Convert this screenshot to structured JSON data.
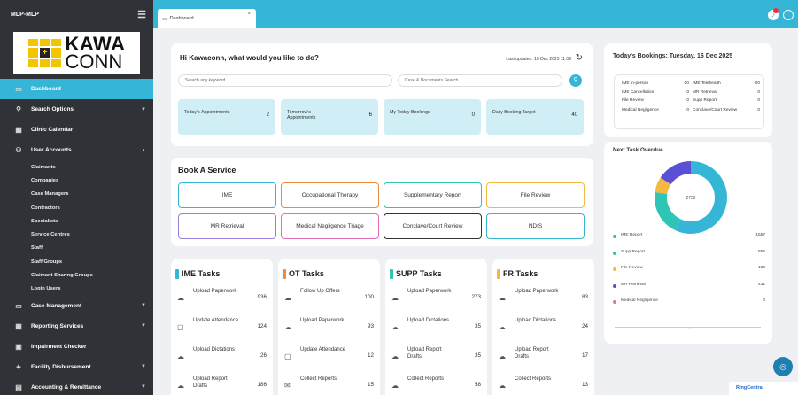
{
  "sidebar": {
    "app_name": "MLP-MLP",
    "logo": {
      "line1": "KAWA",
      "line2": "CONN"
    },
    "items": [
      {
        "label": "Dashboard",
        "icon": "dashboard-icon"
      },
      {
        "label": "Search Options",
        "icon": "search-icon"
      },
      {
        "label": "Clinic Calendar",
        "icon": "calendar-icon"
      },
      {
        "label": "User Accounts",
        "icon": "users-icon"
      }
    ],
    "sub_items": [
      "Claimants",
      "Companies",
      "Case Managers",
      "Contractors",
      "Specialists",
      "Service Centres",
      "Staff",
      "Staff Groups",
      "Claimant Sharing Groups",
      "Login Users"
    ],
    "more_items": [
      {
        "label": "Case Management",
        "icon": "folder-icon"
      },
      {
        "label": "Reporting Services",
        "icon": "grid-icon"
      },
      {
        "label": "Impairment Checker",
        "icon": "checker-icon"
      },
      {
        "label": "Facility Disbursement",
        "icon": "settings-icon"
      },
      {
        "label": "Accounting & Remittance",
        "icon": "accounting-icon"
      }
    ]
  },
  "topbar": {
    "tab_label": "Dashboard"
  },
  "greeting": {
    "title": "Hi Kawaconn, what would you like to do?",
    "updated": "Last updated: 16 Dec 2025 11:09",
    "search_placeholder": "Search any keyword",
    "case_search_placeholder": "Case & Documents Search",
    "stats": [
      {
        "label": "Today's Appointments",
        "value": "2"
      },
      {
        "label": "Tomorrow's Appointments",
        "value": "6"
      },
      {
        "label": "My Today Bookings",
        "value": "0"
      },
      {
        "label": "Daily Booking Target",
        "value": "40"
      }
    ]
  },
  "book": {
    "title": "Book A Service",
    "services": [
      {
        "label": "IME",
        "color": "#35b6d6"
      },
      {
        "label": "Occupational Therapy",
        "color": "#f08a3c"
      },
      {
        "label": "Supplementary Report",
        "color": "#2ec4b6"
      },
      {
        "label": "File Review",
        "color": "#f5b942"
      },
      {
        "label": "MR Retrieval",
        "color": "#9b7fe0"
      },
      {
        "label": "Medical Negligence Triage",
        "color": "#e66bb8"
      },
      {
        "label": "Conclave/Court Review",
        "color": "#333333"
      },
      {
        "label": "NDIS",
        "color": "#35b6d6"
      }
    ]
  },
  "tasks": [
    {
      "title": "IME Tasks",
      "color": "#35b6d6",
      "rows": [
        {
          "icon": "upload-icon",
          "label": "Upload Paperwork",
          "value": "936"
        },
        {
          "icon": "calendar-icon",
          "label": "Update Attendance",
          "value": "124"
        },
        {
          "icon": "upload-icon",
          "label": "Upload Dictations",
          "value": "26"
        },
        {
          "icon": "upload-icon",
          "label": "Upload Report Drafts",
          "value": "186"
        }
      ]
    },
    {
      "title": "OT Tasks",
      "color": "#f08a3c",
      "rows": [
        {
          "icon": "upload-icon",
          "label": "Follow Up Offers",
          "value": "100"
        },
        {
          "icon": "upload-icon",
          "label": "Upload Paperwork",
          "value": "93"
        },
        {
          "icon": "calendar-icon",
          "label": "Update Attendance",
          "value": "12"
        },
        {
          "icon": "mail-icon",
          "label": "Collect Reports",
          "value": "15"
        }
      ]
    },
    {
      "title": "SUPP Tasks",
      "color": "#2ec4b6",
      "rows": [
        {
          "icon": "upload-icon",
          "label": "Upload Paperwork",
          "value": "273"
        },
        {
          "icon": "upload-icon",
          "label": "Upload Dictations",
          "value": "35"
        },
        {
          "icon": "upload-icon",
          "label": "Upload Report Drafts",
          "value": "35"
        },
        {
          "icon": "upload-icon",
          "label": "Collect Reports",
          "value": "58"
        }
      ]
    },
    {
      "title": "FR Tasks",
      "color": "#f5b942",
      "rows": [
        {
          "icon": "upload-icon",
          "label": "Upload Paperwork",
          "value": "83"
        },
        {
          "icon": "upload-icon",
          "label": "Upload Dictations",
          "value": "24"
        },
        {
          "icon": "upload-icon",
          "label": "Upload Report Drafts",
          "value": "17"
        },
        {
          "icon": "upload-icon",
          "label": "Collect Reports",
          "value": "13"
        }
      ]
    }
  ],
  "bookings": {
    "title": "Today's Bookings:  Tuesday, 16 Dec 2025",
    "left": [
      {
        "label": "IME In-person",
        "value": "00"
      },
      {
        "label": "IME Cancellation",
        "value": "0"
      },
      {
        "label": "File Review",
        "value": "0"
      },
      {
        "label": "Medical Negligence",
        "value": "0"
      }
    ],
    "right": [
      {
        "label": "IME Telehealth",
        "value": "00"
      },
      {
        "label": "MR Retrieval",
        "value": "0"
      },
      {
        "label": "Supp Report",
        "value": "0"
      },
      {
        "label": "Conclave/Court Review",
        "value": "0"
      }
    ]
  },
  "overdue": {
    "title": "Next Task Overdue",
    "total": "2732",
    "legend": [
      {
        "label": "IME Report",
        "value": "1557",
        "color": "#35b6d6"
      },
      {
        "label": "Supp Report",
        "value": "556",
        "color": "#2ec4b6"
      },
      {
        "label": "File Review",
        "value": "188",
        "color": "#f5b942"
      },
      {
        "label": "MR Retrieval",
        "value": "431",
        "color": "#5b4fd6"
      },
      {
        "label": "Medical Negligence",
        "value": "0",
        "color": "#e66bb8"
      }
    ]
  },
  "footer": {
    "ringcentral": "RingCentral"
  }
}
